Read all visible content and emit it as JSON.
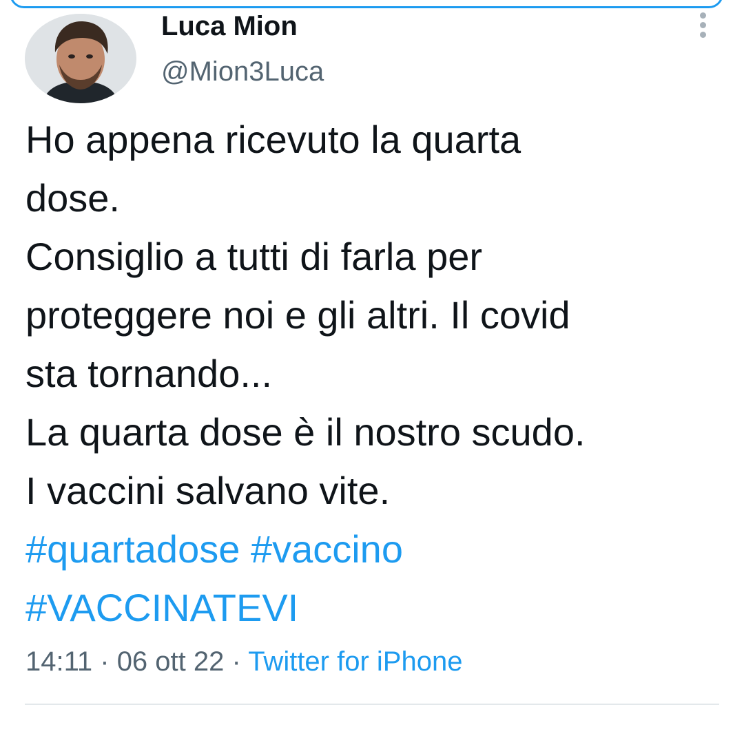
{
  "author": {
    "display_name": "Luca Mion",
    "handle": "@Mion3Luca",
    "avatar_icon": "profile-photo"
  },
  "menu": {
    "icon": "more-vertical-icon"
  },
  "tweet": {
    "lines": [
      "Ho appena ricevuto la quarta",
      "dose.",
      "Consiglio a tutti di farla per",
      "proteggere noi e gli altri. Il covid",
      "sta tornando...",
      "La quarta dose è il nostro scudo.",
      "I vaccini salvano vite."
    ],
    "hashtags": [
      "#quartadose",
      "#vaccino",
      "#VACCINATEVI"
    ]
  },
  "meta": {
    "time": "14:11",
    "sep1": " · ",
    "date": "06 ott 22",
    "sep2": " · ",
    "source": "Twitter for iPhone"
  },
  "colors": {
    "link": "#1d9bf0",
    "text": "#0f1419",
    "secondary": "#536471"
  }
}
